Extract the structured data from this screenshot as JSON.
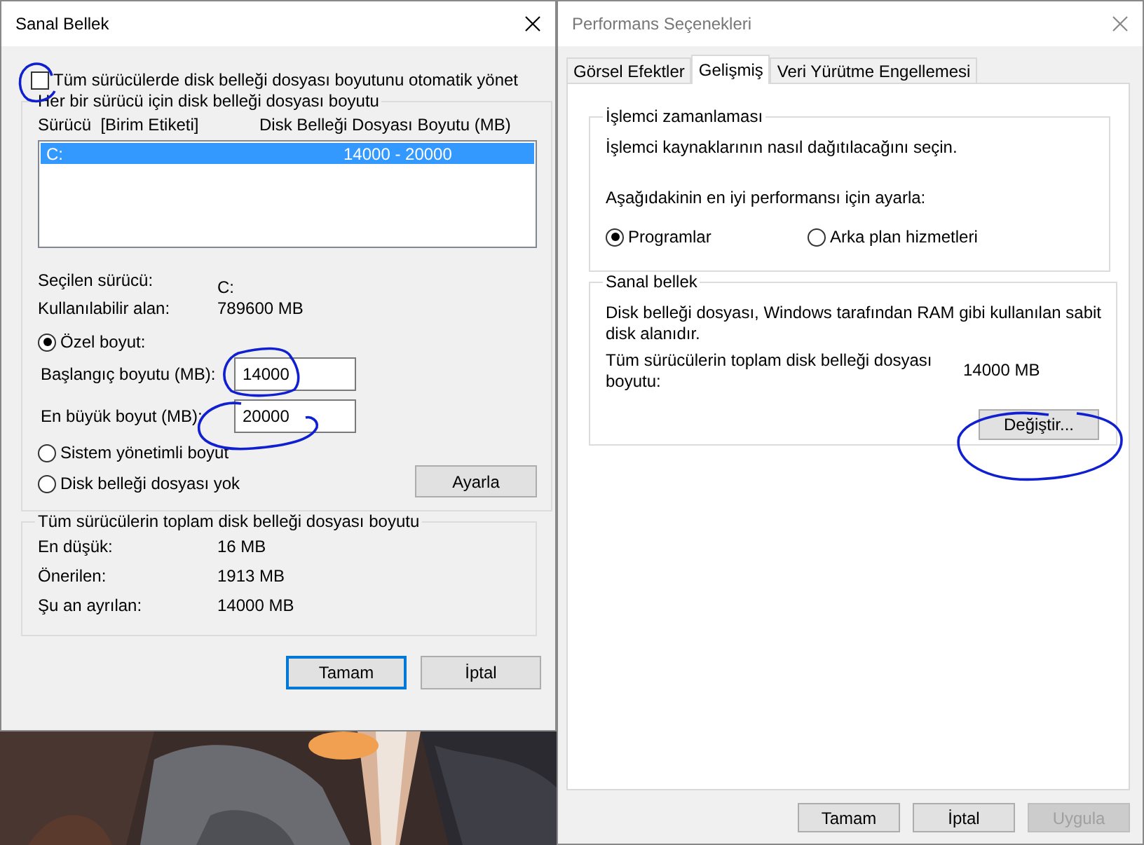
{
  "virtual_memory_dialog": {
    "title": "Sanal Bellek",
    "auto_manage": {
      "label": "Tüm sürücülerde disk belleği dosyası boyutunu otomatik yönet",
      "checked": false
    },
    "drives_group": {
      "title": "Her bir sürücü için disk belleği dosyası boyutu",
      "columns": [
        "Sürücü  [Birim Etiketi]",
        "Disk Belleği Dosyası Boyutu (MB)"
      ],
      "rows": [
        {
          "drive": "C:",
          "size": "14000 - 20000",
          "selected": true
        }
      ],
      "selected_drive_label": "Seçilen sürücü:",
      "selected_drive_value": "C:",
      "available_label": "Kullanılabilir alan:",
      "available_value": "789600 MB",
      "size_options": [
        {
          "label": "Özel boyut:",
          "selected": true
        },
        {
          "label": "Sistem yönetimli boyut",
          "selected": false
        },
        {
          "label": "Disk belleği dosyası yok",
          "selected": false
        }
      ],
      "initial_size": {
        "label": "Başlangıç boyutu (MB):",
        "value": "14000"
      },
      "max_size": {
        "label": "En büyük boyut (MB):",
        "value": "20000"
      },
      "set_button": "Ayarla"
    },
    "total_group": {
      "title": "Tüm sürücülerin toplam disk belleği dosyası boyutu",
      "rows": [
        {
          "label": "En düşük:",
          "value": "16 MB"
        },
        {
          "label": "Önerilen:",
          "value": "1913 MB"
        },
        {
          "label": "Şu an ayrılan:",
          "value": "14000 MB"
        }
      ]
    },
    "buttons": [
      {
        "label": "Tamam",
        "default": true
      },
      {
        "label": "İptal",
        "default": false
      }
    ]
  },
  "performance_options_dialog": {
    "title": "Performans Seçenekleri",
    "tabs": [
      {
        "label": "Görsel Efektler",
        "selected": false
      },
      {
        "label": "Gelişmiş",
        "selected": true
      },
      {
        "label": "Veri Yürütme Engellemesi",
        "selected": false
      }
    ],
    "processor_group": {
      "title": "İşlemci zamanlaması",
      "description": "İşlemci kaynaklarının nasıl dağıtılacağını seçin.",
      "prompt": "Aşağıdakinin en iyi performansı için ayarla:",
      "options": [
        {
          "label": "Programlar",
          "selected": true
        },
        {
          "label": "Arka plan hizmetleri",
          "selected": false
        }
      ]
    },
    "virtual_memory_group": {
      "title": "Sanal bellek",
      "description": "Disk belleği dosyası, Windows tarafından RAM gibi kullanılan sabit disk alanıdır.",
      "total_label": "Tüm sürücülerin toplam disk belleği dosyası boyutu:",
      "total_value": "14000 MB",
      "change_button": "Değiştir..."
    },
    "buttons": [
      {
        "label": "Tamam",
        "disabled": false
      },
      {
        "label": "İptal",
        "disabled": false
      },
      {
        "label": "Uygula",
        "disabled": true
      }
    ]
  }
}
